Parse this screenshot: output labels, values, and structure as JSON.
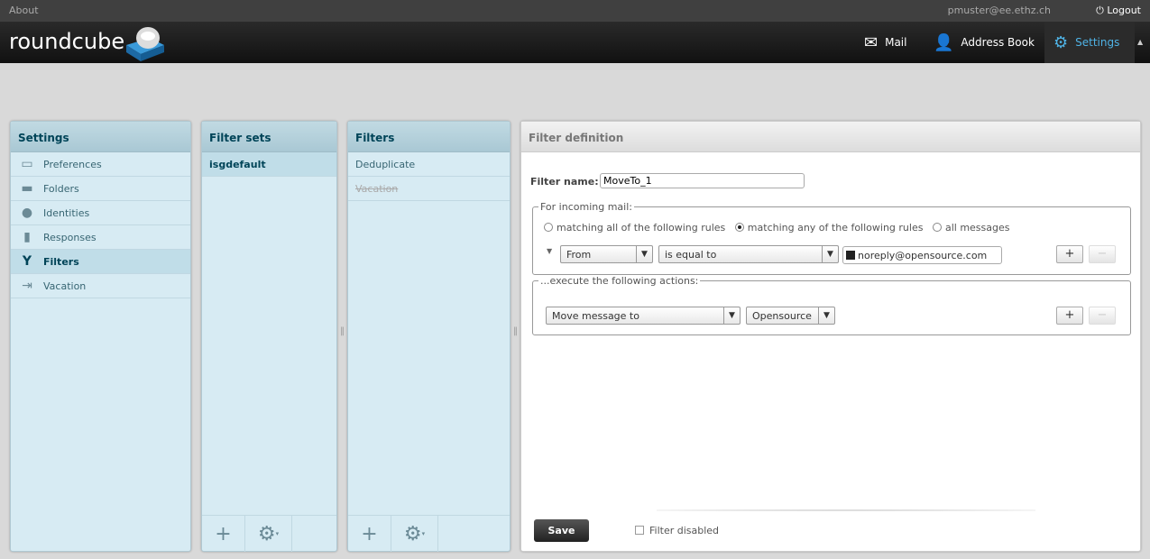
{
  "topbar": {
    "about": "About",
    "user": "pmuster@ee.ethz.ch",
    "logout": "Logout"
  },
  "header": {
    "logo": "roundcube",
    "nav": [
      {
        "label": "Mail",
        "icon": "envelope-icon"
      },
      {
        "label": "Address Book",
        "icon": "person-icon"
      },
      {
        "label": "Settings",
        "icon": "gear-icon",
        "selected": true
      }
    ]
  },
  "settings": {
    "title": "Settings",
    "items": [
      {
        "label": "Preferences",
        "icon": "monitor-icon"
      },
      {
        "label": "Folders",
        "icon": "folder-icon"
      },
      {
        "label": "Identities",
        "icon": "person-icon"
      },
      {
        "label": "Responses",
        "icon": "document-icon"
      },
      {
        "label": "Filters",
        "icon": "filter-icon",
        "selected": true
      },
      {
        "label": "Vacation",
        "icon": "exit-icon"
      }
    ]
  },
  "filter_sets": {
    "title": "Filter sets",
    "items": [
      "isgdefault"
    ]
  },
  "filters": {
    "title": "Filters",
    "items": [
      {
        "label": "Deduplicate"
      },
      {
        "label": "Vacation",
        "disabled": true
      }
    ]
  },
  "definition": {
    "title": "Filter definition",
    "name_label": "Filter name:",
    "name_value": "MoveTo_1",
    "incoming_legend": "For incoming mail:",
    "match_options": [
      "matching all of the following rules",
      "matching any of the following rules",
      "all messages"
    ],
    "match_selected": 1,
    "rule": {
      "header": "From",
      "operator": "is equal to",
      "value": "noreply@opensource.com"
    },
    "actions_legend": "...execute the following actions:",
    "action": {
      "type": "Move message to",
      "folder": "Opensource"
    },
    "plus": "+",
    "minus": "−",
    "save": "Save",
    "disabled_label": "Filter disabled"
  },
  "colors": {
    "accent": "#4fb3e6",
    "panel": "#d7ebf3"
  }
}
